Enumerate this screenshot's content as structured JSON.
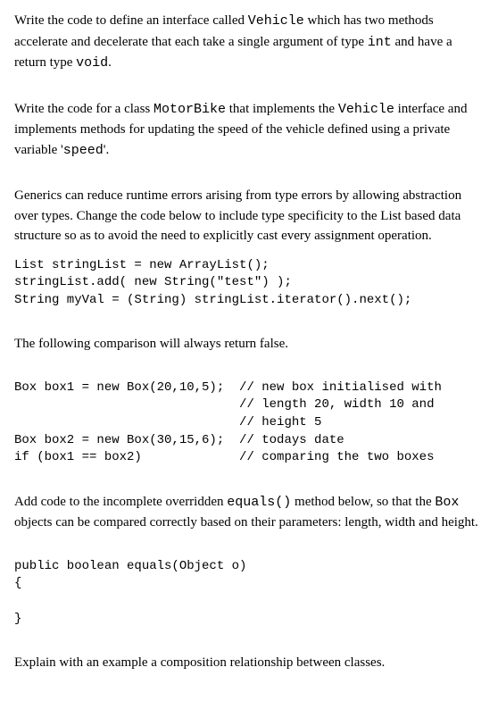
{
  "p1": {
    "pre1": "Write the code to define an interface called ",
    "c1": "Vehicle",
    "post1": " which has two methods accelerate and decelerate that each take a single argument of type ",
    "c2": "int",
    "post2": " and have a return type ",
    "c3": "void",
    "post3": "."
  },
  "p2": {
    "pre1": "Write the code for a class ",
    "c1": "MotorBike",
    "post1": " that implements the ",
    "c2": "Vehicle",
    "post2": " interface and implements methods for updating the speed of the vehicle defined using a private variable '",
    "c3": "speed",
    "post3": "'."
  },
  "p3": "Generics can reduce runtime errors arising from type errors by allowing abstraction over types. Change the code below to include type specificity to the List based data structure so as to avoid the need to explicitly cast every assignment operation.",
  "code1": "List stringList = new ArrayList();\nstringList.add( new String(\"test\") );\nString myVal = (String) stringList.iterator().next();",
  "p4": "The following comparison will always return false.",
  "code2": "Box box1 = new Box(20,10,5);  // new box initialised with\n                              // length 20, width 10 and\n                              // height 5\nBox box2 = new Box(30,15,6);  // todays date\nif (box1 == box2)             // comparing the two boxes",
  "p5": {
    "pre1": "Add code to the incomplete overridden ",
    "c1": "equals()",
    "post1": " method below, so that the ",
    "c2": "Box",
    "post2": " objects can be compared correctly based on their parameters: length, width and height."
  },
  "code3": "public boolean equals(Object o)\n{\n\n}",
  "p6": "Explain with an example a composition relationship between classes."
}
